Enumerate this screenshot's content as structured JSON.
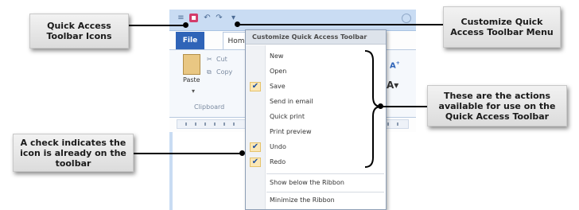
{
  "callouts": {
    "qat_icons": "Quick Access Toolbar Icons",
    "customize_menu": "Customize Quick Access Toolbar  Menu",
    "actions": "These are the actions available for use on the Quick Access  Toolbar",
    "check_note": "A check indicates the icon is already on the toolbar"
  },
  "window": {
    "file_tab": "File",
    "home_tab": "Hom",
    "ribbon": {
      "paste": "Paste",
      "cut": "Cut",
      "copy": "Copy",
      "clipboard": "Clipboard"
    }
  },
  "menu": {
    "header": "Customize Quick Access Toolbar",
    "items": [
      {
        "label": "New",
        "checked": false
      },
      {
        "label": "Open",
        "checked": false
      },
      {
        "label": "Save",
        "checked": true
      },
      {
        "label": "Send in email",
        "checked": false
      },
      {
        "label": "Quick print",
        "checked": false
      },
      {
        "label": "Print preview",
        "checked": false
      },
      {
        "label": "Undo",
        "checked": true
      },
      {
        "label": "Redo",
        "checked": true
      }
    ],
    "show_below": "Show below the Ribbon",
    "minimize": "Minimize the Ribbon"
  },
  "icons": {
    "qat": [
      "menu-icon",
      "save-icon",
      "undo-icon",
      "redo-icon",
      "dropdown-arrow-icon"
    ],
    "check": "checkmark-icon"
  },
  "colors": {
    "file_tab": "#2f64b8",
    "titlebar": "#c9dcf3",
    "check_highlight": "#fbe7b5"
  }
}
